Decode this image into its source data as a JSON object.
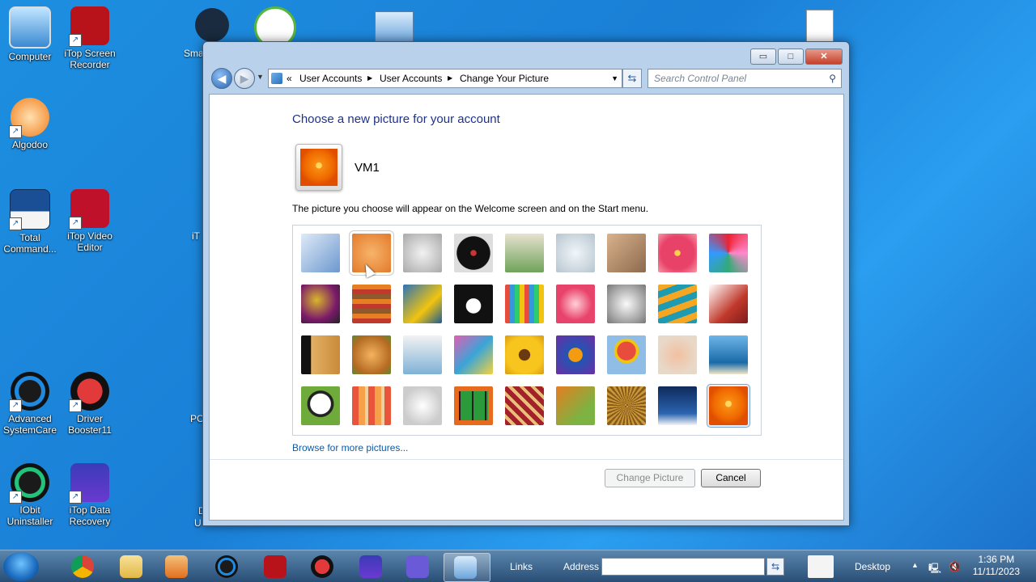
{
  "desktop": {
    "icons": [
      {
        "label": "Computer"
      },
      {
        "label": "iTop Screen\nRecorder"
      },
      {
        "label": "Algodoo"
      },
      {
        "label": "Total\nCommand..."
      },
      {
        "label": "iTop Video\nEditor"
      },
      {
        "label": "Advanced\nSystemCare"
      },
      {
        "label": "Driver\nBooster11"
      },
      {
        "label": "IObit\nUninstaller"
      },
      {
        "label": "iTop Data\nRecovery"
      }
    ],
    "partial_labels": [
      "Sma",
      "iT",
      "PC",
      "D",
      "U"
    ]
  },
  "window": {
    "controls": {
      "minimize": "▭",
      "maximize": "□",
      "close": "✕"
    },
    "breadcrumb": {
      "root": "«",
      "items": [
        "User Accounts",
        "User Accounts",
        "Change Your Picture"
      ],
      "sep": "▶"
    },
    "search_placeholder": "Search Control Panel",
    "heading": "Choose a new picture for your account",
    "account_name": "VM1",
    "description": "The picture you choose will appear on the Welcome screen and on the Start menu.",
    "pictures": [
      "roller-coaster",
      "starfish",
      "robot-toy",
      "record-player",
      "lucky-cat",
      "gyroscope",
      "kitten",
      "pink-flower",
      "pinwheel",
      "ball",
      "fabric",
      "leaf",
      "dog",
      "crayons",
      "star-ornament",
      "jacks",
      "stairs",
      "paper-crane",
      "guitar",
      "pomeranian",
      "tin-robot",
      "scarves",
      "sunflower",
      "fish",
      "hot-air-balloon",
      "daruma",
      "sailboat",
      "soccer-ball",
      "stripes",
      "marbles",
      "window-box",
      "textile",
      "butterfly",
      "basket",
      "lighthouse",
      "orange-flower"
    ],
    "selected_picture": "orange-flower",
    "browse_link": "Browse for more pictures...",
    "buttons": {
      "change": "Change Picture",
      "cancel": "Cancel"
    }
  },
  "taskbar": {
    "links_label": "Links",
    "address_label": "Address",
    "desktop_label": "Desktop",
    "time": "1:36 PM",
    "date": "11/11/2023"
  },
  "colors": {
    "accent": "#1e3287",
    "link": "#0c5ba9",
    "desktop": "#1d8fe0"
  }
}
